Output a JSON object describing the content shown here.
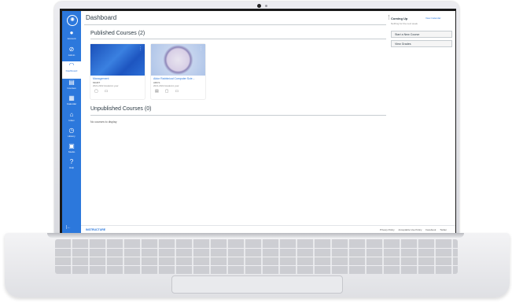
{
  "brand": {
    "accent": "#2c78dc",
    "nav_bg": "#2c78dc"
  },
  "nav": {
    "items": [
      {
        "label": "Account",
        "icon": "account-avatar-icon"
      },
      {
        "label": "Admin",
        "icon": "shield-icon"
      },
      {
        "label": "Dashboard",
        "icon": "dashboard-icon"
      },
      {
        "label": "Courses",
        "icon": "book-icon"
      },
      {
        "label": "Calendar",
        "icon": "calendar-icon"
      },
      {
        "label": "Inbox",
        "icon": "inbox-icon"
      },
      {
        "label": "History",
        "icon": "clock-icon"
      },
      {
        "label": "Studio",
        "icon": "studio-icon"
      },
      {
        "label": "Help",
        "icon": "help-icon"
      }
    ],
    "collapse": "|←"
  },
  "header": {
    "title": "Dashboard",
    "kebab": "⋮"
  },
  "published": {
    "heading": "Published Courses (2)",
    "cards": [
      {
        "title": "Management",
        "code": "MGMT",
        "term": "2021-2022 Academic year",
        "color": "#2563c4"
      },
      {
        "title": "Aldor Rabbinical Computer Scie...",
        "code": "ARCS",
        "term": "2021-2022 Academic year",
        "color": "#c3d2ea"
      }
    ]
  },
  "unpublished": {
    "heading": "Unpublished Courses (0)",
    "empty": "No courses to display"
  },
  "sidebar": {
    "heading": "Coming Up",
    "link": "View Calendar",
    "sub": "Nothing for the next week",
    "buttons": [
      "Start a New Course",
      "View Grades"
    ]
  },
  "footer": {
    "logo": "INSTRUCTURE",
    "links": [
      "Privacy Policy",
      "Acceptable Use Policy",
      "Facebook",
      "Twitter"
    ]
  }
}
